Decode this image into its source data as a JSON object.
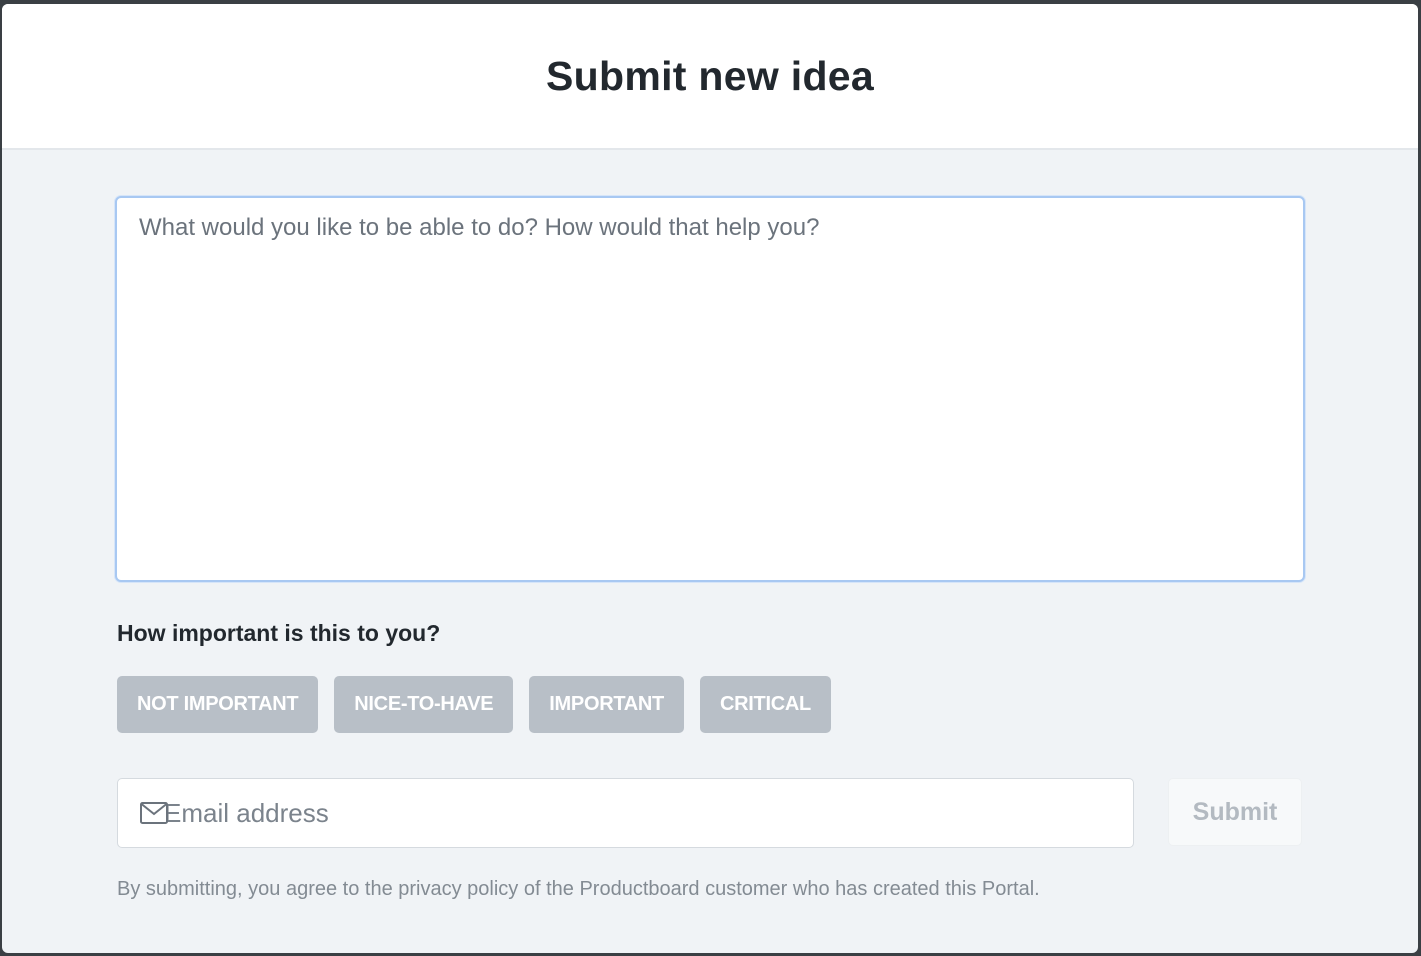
{
  "modal": {
    "title": "Submit new idea"
  },
  "idea": {
    "placeholder": "What would you like to be able to do? How would that help you?",
    "value": ""
  },
  "importance": {
    "label": "How important is this to you?",
    "options": [
      "NOT IMPORTANT",
      "NICE-TO-HAVE",
      "IMPORTANT",
      "CRITICAL"
    ]
  },
  "email": {
    "placeholder": "Email address",
    "icon": "mail-icon"
  },
  "submit": {
    "label": "Submit"
  },
  "privacy": {
    "text": "By submitting, you agree to the privacy policy of the Productboard customer who has created this Portal."
  },
  "colors": {
    "option_bg": "#b8bfc7",
    "focus_border": "#a8c8f2",
    "body_bg": "#f0f3f6"
  }
}
